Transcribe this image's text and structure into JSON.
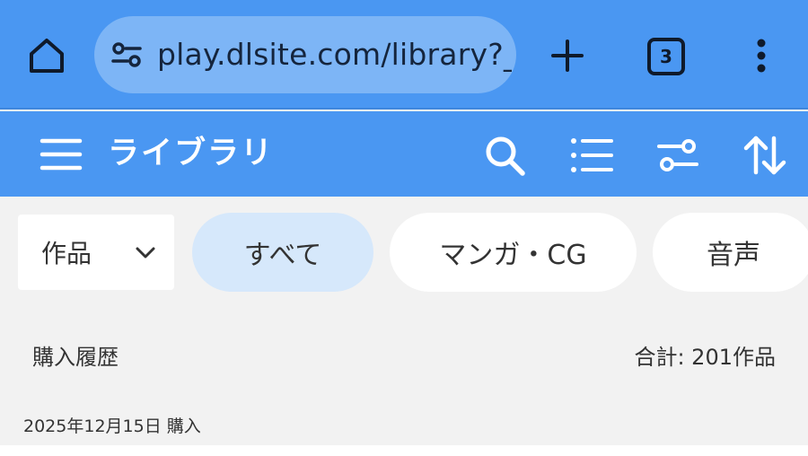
{
  "browser": {
    "url": "play.dlsite.com/library?_",
    "tab_count": "3",
    "icons": {
      "home": "home-icon",
      "site_settings": "tune-icon",
      "new_tab": "plus-icon",
      "tabs": "tab-switcher-icon",
      "menu": "more-vert-icon"
    }
  },
  "header": {
    "title": "ライブラリ",
    "icons": [
      "menu-icon",
      "search-icon",
      "list-view-icon",
      "filter-icon",
      "sort-icon"
    ]
  },
  "filters": {
    "type_select": {
      "selected": "作品"
    },
    "chips": [
      {
        "label": "すべて",
        "active": true
      },
      {
        "label": "マンガ・CG",
        "active": false
      },
      {
        "label": "音声",
        "active": false
      }
    ]
  },
  "section": {
    "label": "購入履歴",
    "total": "合計: 201作品"
  },
  "groups": [
    {
      "date": "2025年12月15日 購入"
    }
  ],
  "colors": {
    "header_bg": "#4a97f2",
    "url_box_bg": "#7db5f6",
    "chip_active_bg": "#d6e8fb",
    "page_bg": "#f2f2f2"
  }
}
